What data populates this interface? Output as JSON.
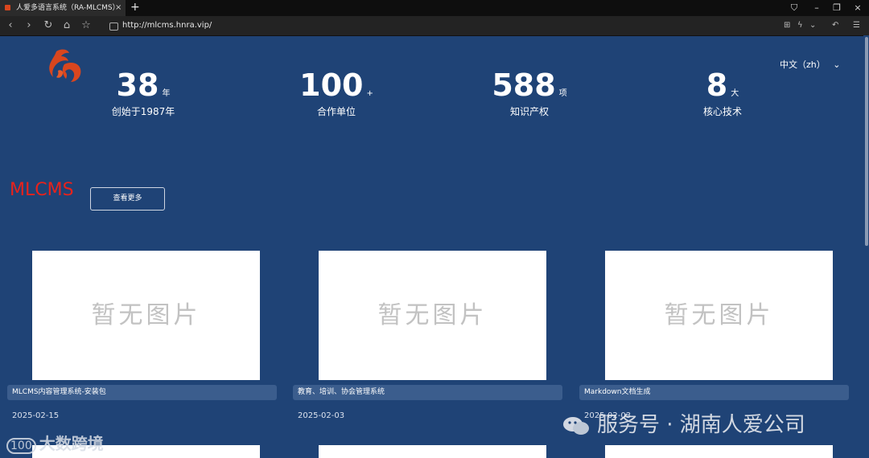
{
  "browser": {
    "tab_title": "人爱多语言系统（RA-MLCMS）",
    "tab_close": "×",
    "new_tab": "+",
    "url": "http://mlcms.hnra.vip/",
    "nav": {
      "back": "‹",
      "forward": "›",
      "reload": "↻",
      "home": "⌂",
      "bookmark": "☆"
    },
    "window": {
      "minimize": "–",
      "restore": "❐",
      "close": "×",
      "ext": "⛉"
    },
    "tools": {
      "grid": "⊞",
      "flash": "ϟ",
      "dropdown": "⌄",
      "undo": "↶",
      "menu": "☰"
    }
  },
  "stats": [
    {
      "value": "38",
      "unit": "年",
      "label": "创始于1987年"
    },
    {
      "value": "100",
      "unit": "+",
      "label": "合作单位"
    },
    {
      "value": "588",
      "unit": "项",
      "label": "知识产权"
    },
    {
      "value": "8",
      "unit": "大",
      "label": "核心技术"
    }
  ],
  "language": {
    "label": "中文（zh）",
    "chevron": "⌄"
  },
  "section": {
    "brand": "MLCMS",
    "more_button": "查看更多"
  },
  "cards": [
    {
      "placeholder": "暂无图片",
      "title": "MLCMS内容管理系统-安装包",
      "date": "2025-02-15"
    },
    {
      "placeholder": "暂无图片",
      "title": "教育、培训、协会管理系统",
      "date": "2025-02-03"
    },
    {
      "placeholder": "暂无图片",
      "title": "Markdown文档生成",
      "date": "2025-02-03"
    }
  ],
  "watermarks": {
    "left": "大数跨境",
    "right": "服务号 · 湖南人爱公司"
  },
  "colors": {
    "page_bg": "#1f4376",
    "brand_red": "#e8221b",
    "card_title_bg": "#3b5d8d"
  }
}
